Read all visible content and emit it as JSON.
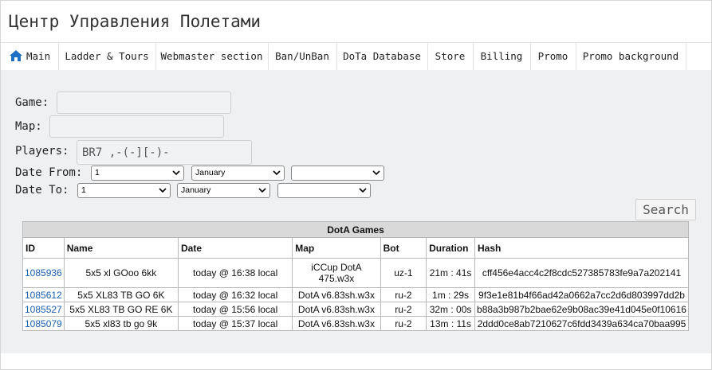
{
  "header": {
    "title": "Центр Управления Полетами"
  },
  "nav": {
    "items": [
      {
        "label": "Main"
      },
      {
        "label": "Ladder & Tours"
      },
      {
        "label": "Webmaster section"
      },
      {
        "label": "Ban/UnBan"
      },
      {
        "label": "DoTa Database"
      },
      {
        "label": "Store"
      },
      {
        "label": "Billing"
      },
      {
        "label": "Promo"
      },
      {
        "label": "Promo background"
      }
    ]
  },
  "form": {
    "game_label": "Game:",
    "map_label": "Map:",
    "players_label": "Players:",
    "players_value": "BR7 ,-(-][-)-",
    "date_from_label": "Date From:",
    "date_to_label": "Date To:",
    "date_from": {
      "day": "1",
      "month": "January",
      "year": ""
    },
    "date_to": {
      "day": "1",
      "month": "January",
      "year": ""
    },
    "search_label": "Search"
  },
  "table": {
    "caption": "DotA Games",
    "columns": [
      "ID",
      "Name",
      "Date",
      "Map",
      "Bot",
      "Duration",
      "Hash"
    ],
    "rows": [
      {
        "id": "1085936",
        "name": "5x5 xl GOoo 6kk",
        "date": "today @ 16:38 local",
        "map": "iCCup DotA 475.w3x",
        "bot": "uz-1",
        "duration": "21m : 41s",
        "hash": "cff456e4acc4c2f8cdc527385783fe9a7a202141"
      },
      {
        "id": "1085612",
        "name": "5x5 XL83 TB GO 6K",
        "date": "today @ 16:32 local",
        "map": "DotA v6.83sh.w3x",
        "bot": "ru-2",
        "duration": "1m : 29s",
        "hash": "9f3e1e81b4f66ad42a0662a7cc2d6d803997dd2b"
      },
      {
        "id": "1085527",
        "name": "5x5 XL83 TB GO RE 6K",
        "date": "today @ 15:56 local",
        "map": "DotA v6.83sh.w3x",
        "bot": "ru-2",
        "duration": "32m : 00s",
        "hash": "b88a3b987b2bae62e9b08ac39e41d045e0f10616"
      },
      {
        "id": "1085079",
        "name": "5x5 xl83 tb go 9k",
        "date": "today @ 15:37 local",
        "map": "DotA v6.83sh.w3x",
        "bot": "ru-2",
        "duration": "13m : 11s",
        "hash": "2ddd0ce8ab7210627c6fdd3439a634ca70baa995"
      }
    ]
  },
  "colors": {
    "link": "#1a5fb0",
    "home_icon": "#1f6fc5",
    "content_bg": "#eef0f1"
  }
}
